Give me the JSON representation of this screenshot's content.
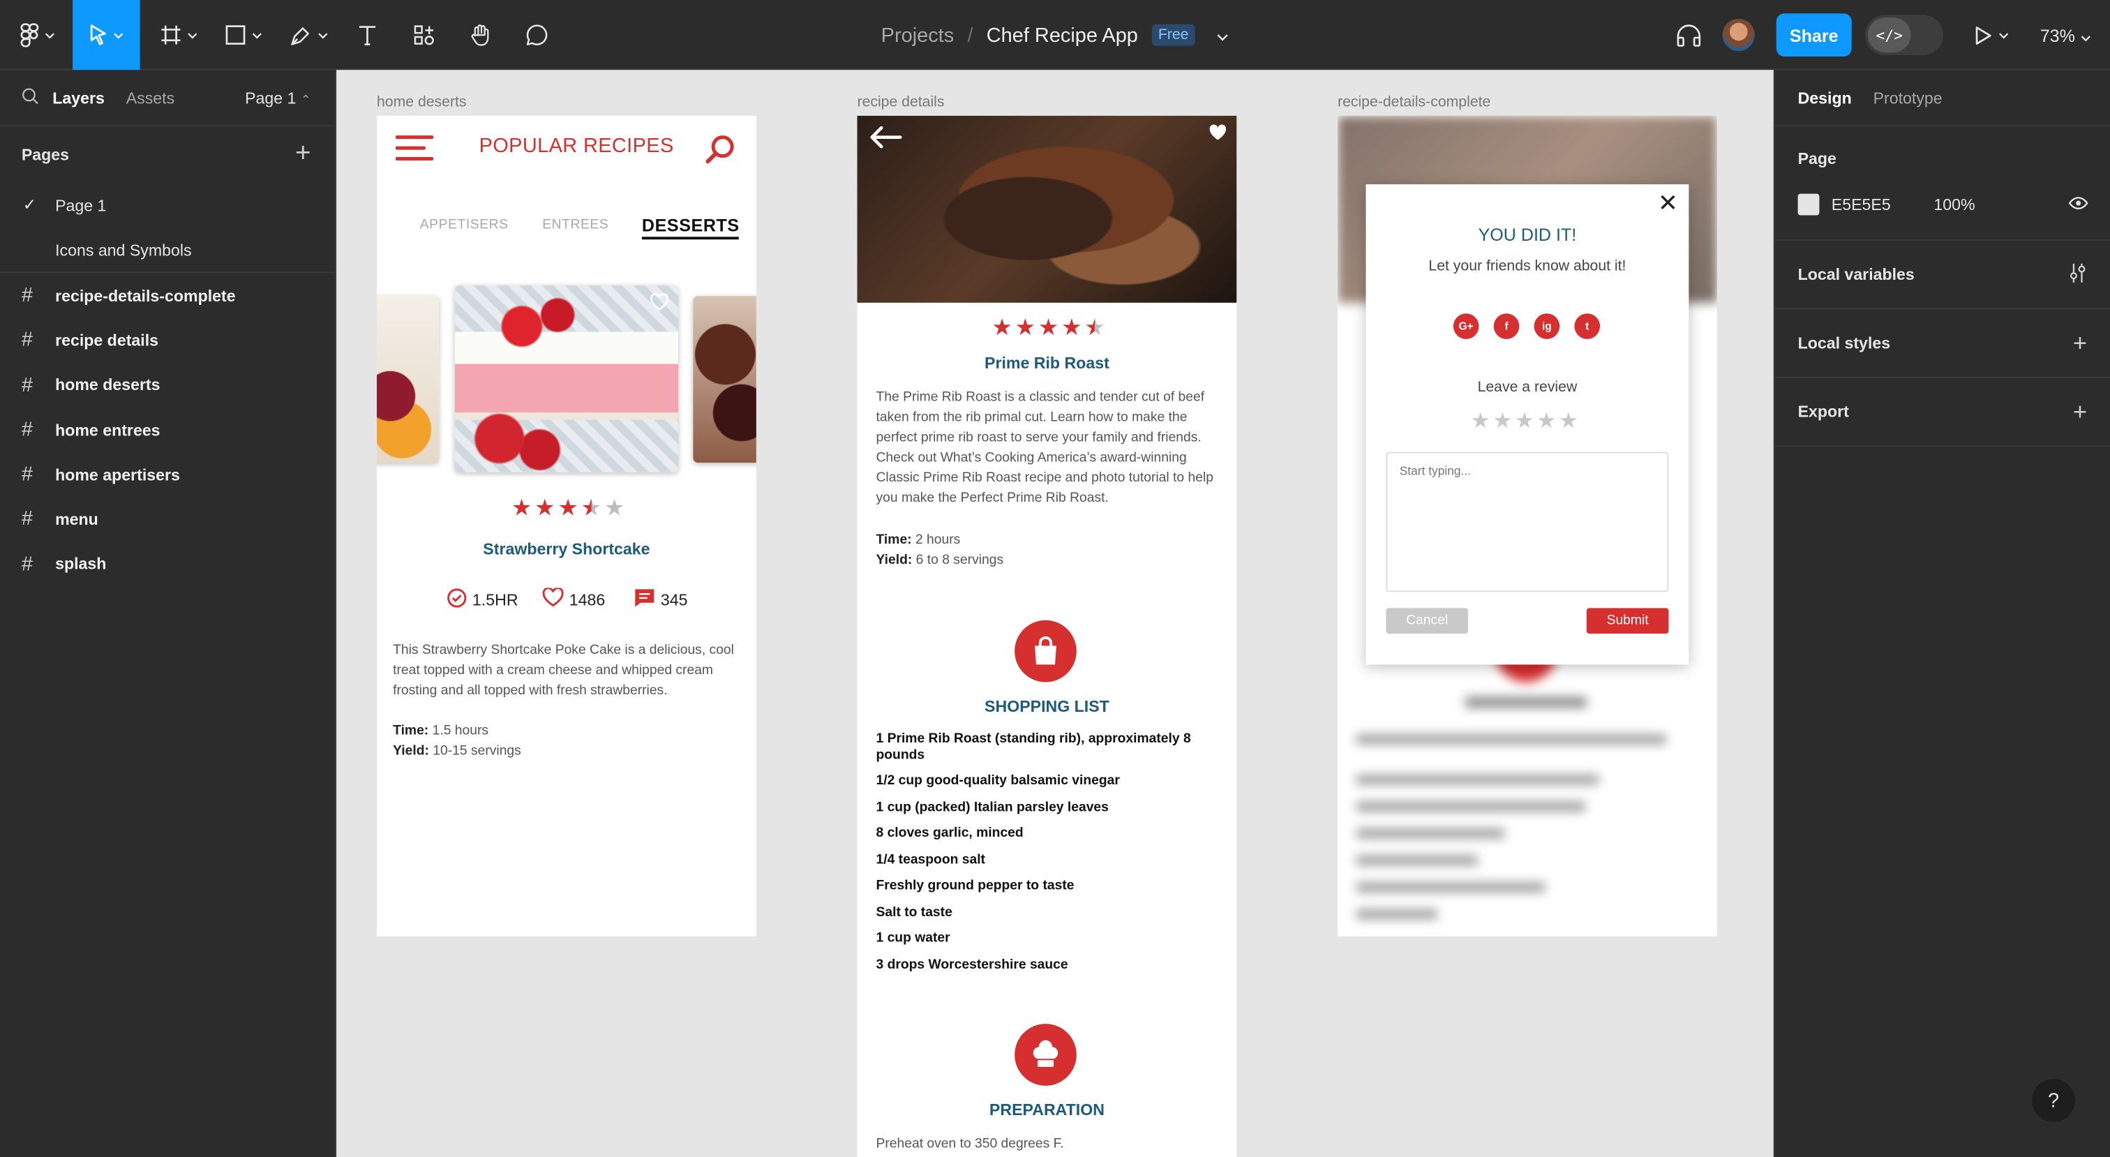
{
  "toolbar": {
    "file": {
      "projects": "Projects",
      "separator": "/",
      "name": "Chef Recipe App",
      "plan": "Free"
    },
    "share_label": "Share",
    "dev_mode_icon": "</>",
    "zoom": "73%"
  },
  "left_panel": {
    "tabs": [
      "Layers",
      "Assets"
    ],
    "current_page": "Page 1",
    "pages_heading": "Pages",
    "pages": [
      "Page 1",
      "Icons and Symbols"
    ],
    "frames": [
      "recipe-details-complete",
      "recipe details",
      "home deserts",
      "home entrees",
      "home apertisers",
      "menu",
      "splash"
    ]
  },
  "right_panel": {
    "tabs": [
      "Design",
      "Prototype"
    ],
    "page_heading": "Page",
    "page_fill": "E5E5E5",
    "page_opacity": "100%",
    "sections": [
      "Local variables",
      "Local styles",
      "Export"
    ],
    "help": "?"
  },
  "canvas": {
    "frame1": {
      "label": "home deserts",
      "title": "POPULAR RECIPES",
      "categories": [
        "APPETISERS",
        "ENTREES",
        "DESSERTS"
      ],
      "rating": 3.5,
      "recipe_name": "Strawberry Shortcake",
      "stats": {
        "time": "1.5HR",
        "likes": "1486",
        "comments": "345"
      },
      "description": "This Strawberry Shortcake Poke Cake is a delicious, cool treat topped with a cream cheese and whipped cream frosting and all topped with fresh strawberries.",
      "time_label": "Time:",
      "time_value": "1.5 hours",
      "yield_label": "Yield:",
      "yield_value": "10-15 servings"
    },
    "frame2": {
      "label": "recipe details",
      "rating": 4.5,
      "recipe_name": "Prime Rib Roast",
      "description": "The Prime Rib Roast is a classic and tender cut of beef taken from the rib primal cut.  Learn how to make the perfect prime rib roast to serve your family and friends.  Check out What’s Cooking America’s award-winning Classic Prime Rib Roast recipe and photo tutorial to help you make the Perfect Prime Rib Roast.",
      "time_label": "Time:",
      "time_value": "2 hours",
      "yield_label": "Yield:",
      "yield_value": "6 to 8 servings",
      "shopping_title": "SHOPPING LIST",
      "ingredients": [
        "1 Prime Rib Roast (standing rib), approximately 8 pounds",
        "1/2 cup good-quality balsamic vinegar",
        "1 cup (packed) Italian parsley leaves",
        "8 cloves garlic, minced",
        "1/4 teaspoon salt",
        "Freshly ground pepper to taste",
        "Salt to taste",
        "1 cup water",
        "3 drops Worcestershire sauce"
      ],
      "prep_title": "PREPARATION",
      "prep_first": "Preheat oven to 350 degrees F."
    },
    "frame3": {
      "label": "recipe-details-complete",
      "modal_title": "YOU DID IT!",
      "modal_sub": "Let your friends know about it!",
      "social": [
        "G+",
        "f",
        "ig",
        "t"
      ],
      "review_label": "Leave a review",
      "review_placeholder": "Start typing...",
      "cancel": "Cancel",
      "submit": "Submit"
    }
  },
  "colors": {
    "accent_red": "#d62f2f",
    "title_blue": "#1e5a7c",
    "figma_blue": "#0d99ff",
    "panel_bg": "#2c2c2c",
    "canvas_bg": "#e5e5e5"
  }
}
